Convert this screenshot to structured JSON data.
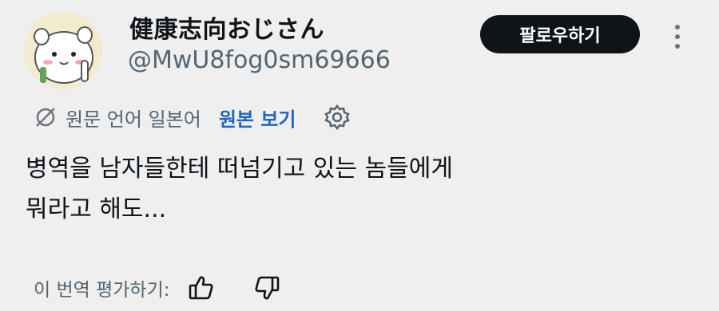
{
  "author": {
    "display_name": "健康志向おじさん",
    "handle": "@MwU8fog0sm69666"
  },
  "follow_button": {
    "label": "팔로우하기"
  },
  "more_icon": "more-vertical-icon",
  "translation": {
    "icon": "translate-icon",
    "source_language": "원문 언어 일본어",
    "view_original_label": "원본 보기",
    "settings_icon": "gear-icon"
  },
  "tweet": {
    "text_line1": "병역을 남자들한테 떠넘기고 있는 놈들에게",
    "text_line2": "뭐라고 해도..."
  },
  "rating": {
    "label": "이 번역 평가하기:",
    "thumbs_up_icon": "thumbs-up-icon",
    "thumbs_down_icon": "thumbs-down-icon"
  },
  "colors": {
    "background": "#efefef",
    "follow_button_bg": "#0f1419",
    "link_blue": "#1d66c2",
    "muted_gray": "#536471"
  }
}
